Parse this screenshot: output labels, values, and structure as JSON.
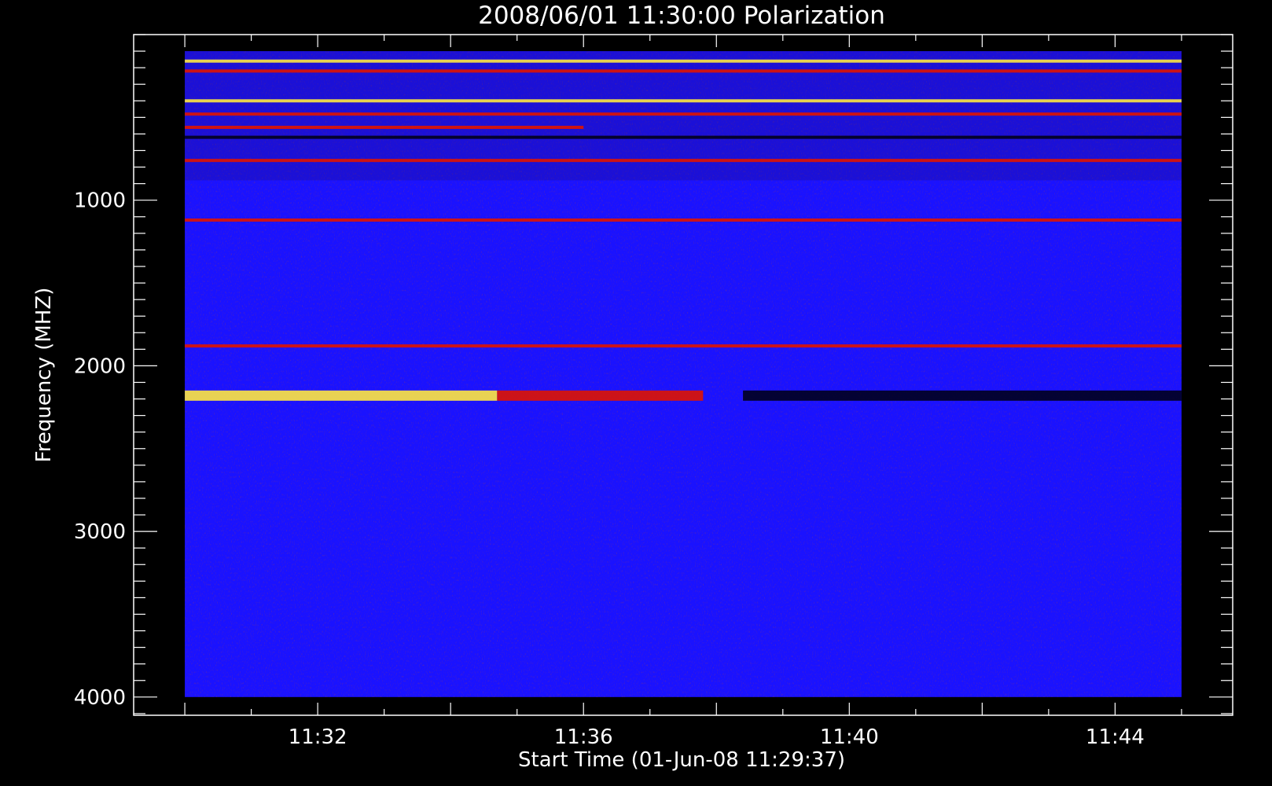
{
  "chart_data": {
    "type": "heatmap",
    "title": "2008/06/01 11:30:00 Polarization",
    "xlabel": "Start Time (01-Jun-08 11:29:37)",
    "ylabel": "Frequency (MHZ)",
    "x_tick_labels": [
      "11:32",
      "11:36",
      "11:40",
      "11:44"
    ],
    "x_tick_minutes": [
      2,
      6,
      10,
      14
    ],
    "y_ticks": [
      1000,
      2000,
      3000,
      4000
    ],
    "xlim_minutes": [
      -0.77,
      15.77
    ],
    "ylim": [
      4110,
      0
    ],
    "data_xlim_minutes": [
      0,
      15
    ],
    "data_ylim": [
      100,
      4000
    ],
    "grid": false,
    "legend": "none",
    "colors": {
      "background": "#000000",
      "foreground": "#ffffff",
      "base": "#1a12ff",
      "red": "#e01400",
      "yellow": "#ffe840",
      "dark": "#000010"
    },
    "bands": [
      {
        "freq": 160,
        "x_start": 0,
        "x_end": 15,
        "color": "yellow"
      },
      {
        "freq": 220,
        "x_start": 0,
        "x_end": 15,
        "color": "red"
      },
      {
        "freq": 400,
        "x_start": 0,
        "x_end": 15,
        "color": "yellow"
      },
      {
        "freq": 480,
        "x_start": 0,
        "x_end": 15,
        "color": "red"
      },
      {
        "freq": 560,
        "x_start": 0,
        "x_end": 6,
        "color": "red"
      },
      {
        "freq": 620,
        "x_start": 0,
        "x_end": 15,
        "color": "dark"
      },
      {
        "freq": 760,
        "x_start": 0,
        "x_end": 15,
        "color": "red"
      },
      {
        "freq": 1120,
        "x_start": 0,
        "x_end": 15,
        "color": "red"
      },
      {
        "freq": 1880,
        "x_start": 0,
        "x_end": 15,
        "color": "red"
      },
      {
        "freq": 2180,
        "x_start": 0,
        "x_end": 4.7,
        "color": "yellow"
      },
      {
        "freq": 2180,
        "x_start": 4.7,
        "x_end": 7.8,
        "color": "red"
      },
      {
        "freq": 2180,
        "x_start": 8.4,
        "x_end": 15,
        "color": "dark"
      }
    ]
  }
}
